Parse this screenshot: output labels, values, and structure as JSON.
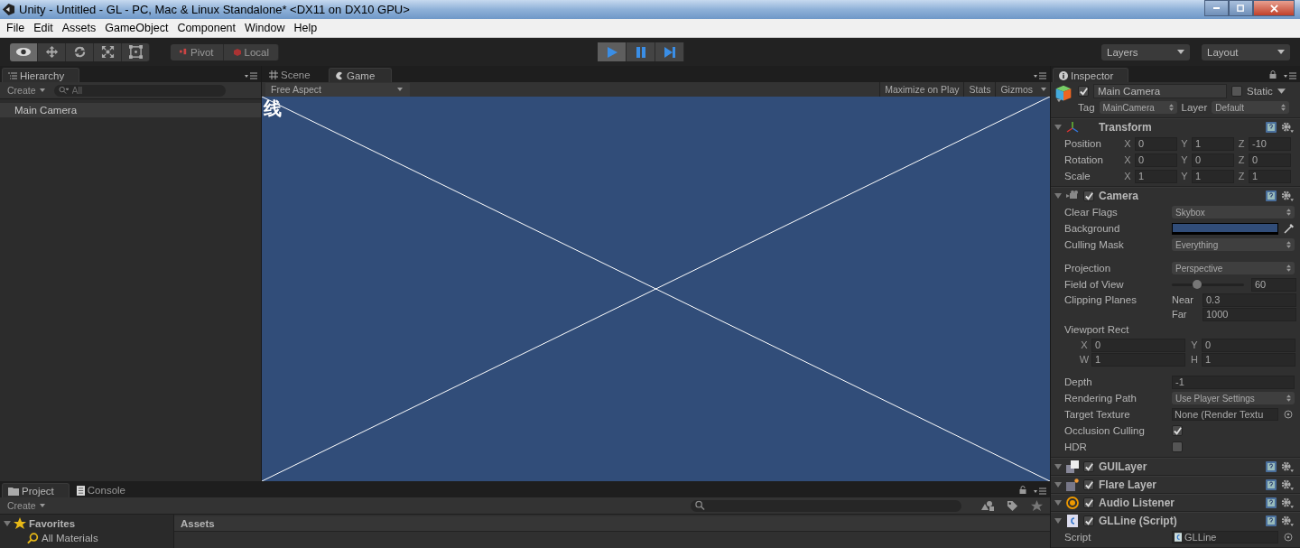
{
  "window": {
    "title": "Unity - Untitled - GL - PC, Mac & Linux Standalone* <DX11 on DX10 GPU>"
  },
  "menu": [
    "File",
    "Edit",
    "Assets",
    "GameObject",
    "Component",
    "Window",
    "Help"
  ],
  "toolbar": {
    "tools": [
      {
        "kind": "view",
        "selected": true
      },
      {
        "kind": "move",
        "selected": false
      },
      {
        "kind": "rotate",
        "selected": false
      },
      {
        "kind": "scale",
        "selected": false
      },
      {
        "kind": "rect",
        "selected": false
      }
    ],
    "pivot": "Pivot",
    "local": "Local",
    "playback": [
      {
        "kind": "play",
        "selected": true
      },
      {
        "kind": "pause",
        "selected": false
      },
      {
        "kind": "step",
        "selected": false
      }
    ],
    "layers": "Layers",
    "layout": "Layout"
  },
  "hierarchy": {
    "tab": "Hierarchy",
    "create": "Create",
    "search_placeholder": "All",
    "items": [
      {
        "label": "Main Camera",
        "selected": true
      }
    ]
  },
  "view_tabs": [
    {
      "label": "Scene",
      "kind": "scene",
      "selected": false
    },
    {
      "label": "Game",
      "kind": "game",
      "selected": true
    }
  ],
  "game": {
    "aspect": "Free Aspect",
    "buttons": [
      "Maximize on Play",
      "Stats",
      "Gizmos"
    ],
    "overlay_text": "线"
  },
  "inspector": {
    "tab": "Inspector",
    "object": {
      "active": true,
      "name": "Main Camera",
      "static": false,
      "static_label": "Static",
      "tag_label": "Tag",
      "tag": "MainCamera",
      "layer_label": "Layer",
      "layer": "Default"
    },
    "components": [
      {
        "kind": "transform",
        "title": "Transform",
        "rows": [
          {
            "kind": "vector",
            "label": "Position",
            "fields": [
              {
                "axis": "X",
                "value": "0"
              },
              {
                "axis": "Y",
                "value": "1"
              },
              {
                "axis": "Z",
                "value": "-10"
              }
            ]
          },
          {
            "kind": "vector",
            "label": "Rotation",
            "fields": [
              {
                "axis": "X",
                "value": "0"
              },
              {
                "axis": "Y",
                "value": "0"
              },
              {
                "axis": "Z",
                "value": "0"
              }
            ]
          },
          {
            "kind": "vector",
            "label": "Scale",
            "fields": [
              {
                "axis": "X",
                "value": "1"
              },
              {
                "axis": "Y",
                "value": "1"
              },
              {
                "axis": "Z",
                "value": "1"
              }
            ]
          }
        ]
      },
      {
        "kind": "camera",
        "title": "Camera",
        "enabled": true,
        "sections": [
          {
            "rows": [
              {
                "kind": "dropdown",
                "label": "Clear Flags",
                "value": "Skybox"
              },
              {
                "kind": "color",
                "label": "Background",
                "color": "#314d79"
              },
              {
                "kind": "dropdown",
                "label": "Culling Mask",
                "value": "Everything"
              }
            ]
          },
          {
            "rows": [
              {
                "kind": "dropdown",
                "label": "Projection",
                "value": "Perspective"
              },
              {
                "kind": "slider",
                "label": "Field of View",
                "level": 0.35,
                "value": "60"
              },
              {
                "kind": "clip",
                "label": "Clipping Planes",
                "fields": [
                  {
                    "axis": "Near",
                    "value": "0.3"
                  },
                  {
                    "axis": "Far",
                    "value": "1000"
                  }
                ]
              },
              {
                "kind": "rect",
                "label": "Viewport Rect",
                "fields": [
                  {
                    "axis": "X",
                    "value": "0"
                  },
                  {
                    "axis": "Y",
                    "value": "0"
                  },
                  {
                    "axis": "W",
                    "value": "1"
                  },
                  {
                    "axis": "H",
                    "value": "1"
                  }
                ]
              }
            ]
          },
          {
            "rows": [
              {
                "kind": "number",
                "label": "Depth",
                "value": "-1"
              },
              {
                "kind": "dropdown",
                "label": "Rendering Path",
                "value": "Use Player Settings"
              },
              {
                "kind": "object",
                "label": "Target Texture",
                "value": "None (Render Textu"
              },
              {
                "kind": "checkbox",
                "label": "Occlusion Culling",
                "checked": true
              },
              {
                "kind": "checkbox",
                "label": "HDR",
                "checked": false
              }
            ]
          }
        ]
      },
      {
        "kind": "guilayer",
        "title": "GUILayer",
        "enabled": true
      },
      {
        "kind": "flare",
        "title": "Flare Layer",
        "enabled": true
      },
      {
        "kind": "audio",
        "title": "Audio Listener",
        "enabled": true
      },
      {
        "kind": "script",
        "title": "GLLine (Script)",
        "enabled": true,
        "rows": [
          {
            "kind": "object",
            "label": "Script",
            "value": "GLLine",
            "script_icon": true
          }
        ]
      }
    ]
  },
  "bottom_tabs": [
    {
      "label": "Project",
      "kind": "project",
      "selected": true
    },
    {
      "label": "Console",
      "kind": "console",
      "selected": false
    }
  ],
  "project": {
    "create": "Create",
    "favorites": {
      "label": "Favorites",
      "expanded": true,
      "children": [
        {
          "label": "All Materials"
        }
      ]
    },
    "assets_header": "Assets"
  }
}
